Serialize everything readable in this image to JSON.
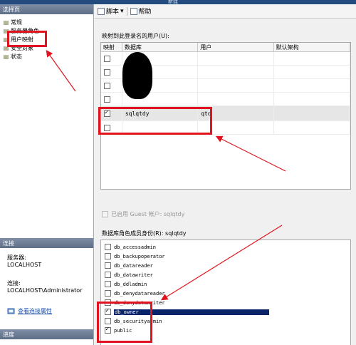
{
  "window": {
    "title_fragment": "新建"
  },
  "left_pane": {
    "select_page_header": "选择页",
    "nav_items": [
      {
        "label": "常规",
        "icon": "page-icon",
        "selected": false
      },
      {
        "label": "服务器角色",
        "icon": "page-icon",
        "selected": false
      },
      {
        "label": "用户映射",
        "icon": "page-icon",
        "selected": true
      },
      {
        "label": "安全对象",
        "icon": "page-icon",
        "selected": false
      },
      {
        "label": "状态",
        "icon": "page-icon",
        "selected": false
      }
    ],
    "connection_header": "连接",
    "server_label": "服务器:",
    "server_value": "LOCALHOST",
    "connection_label": "连接:",
    "connection_value": "LOCALHOST\\Administrator",
    "view_connection_link": "查看连接属性",
    "progress_header": "进度"
  },
  "toolbar": {
    "script_label": "脚本",
    "help_label": "帮助"
  },
  "mapping": {
    "label": "映射到此登录名的用户(U):",
    "columns": [
      "映射",
      "数据库",
      "用户",
      "默认架构"
    ],
    "rows": [
      {
        "checked": false,
        "database": "",
        "user": "",
        "schema": ""
      },
      {
        "checked": false,
        "database": "",
        "user": "",
        "schema": ""
      },
      {
        "checked": false,
        "database": "",
        "user": "",
        "schema": ""
      },
      {
        "checked": false,
        "database": "",
        "user": "",
        "schema": ""
      },
      {
        "checked": true,
        "database": "sqlqtdy",
        "user": "qtd",
        "schema": ""
      },
      {
        "checked": false,
        "database": "",
        "user": "",
        "schema": ""
      }
    ]
  },
  "guest": {
    "label": "已启用 Guest 帐户: sqlqtdy"
  },
  "roles": {
    "label": "数据库角色成员身份(R): sqlqtdy",
    "items": [
      {
        "name": "db_accessadmin",
        "checked": false
      },
      {
        "name": "db_backupoperator",
        "checked": false
      },
      {
        "name": "db_datareader",
        "checked": false
      },
      {
        "name": "db_datawriter",
        "checked": false
      },
      {
        "name": "db_ddladmin",
        "checked": false
      },
      {
        "name": "db_denydatareader",
        "checked": false
      },
      {
        "name": "db_denydatawriter",
        "checked": false
      },
      {
        "name": "db_owner",
        "checked": true,
        "selected": true
      },
      {
        "name": "db_securityadmin",
        "checked": false
      },
      {
        "name": "public",
        "checked": true
      }
    ]
  },
  "colors": {
    "annotation": "#e0141e",
    "selection": "#0a246a",
    "header": "#5f6f88"
  }
}
